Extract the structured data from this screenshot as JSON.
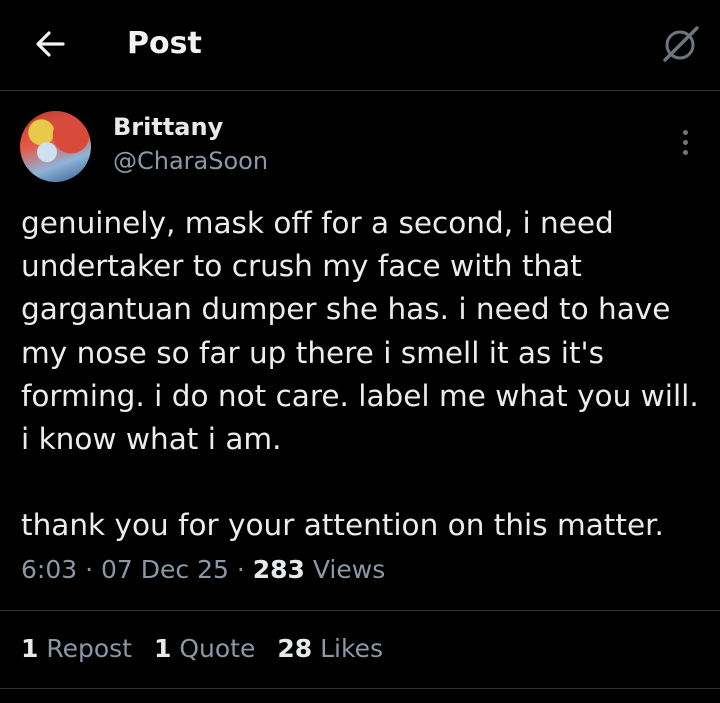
{
  "header": {
    "title": "Post",
    "back_icon": "arrow-left-icon",
    "grok_icon": "grok-icon"
  },
  "author": {
    "name": "Brittany",
    "handle": "@CharaSoon"
  },
  "post": {
    "text": "genuinely, mask off for a second, i need\nundertaker to crush my face with that\ngargantuan dumper she has. i need to have\nmy nose so far up there i smell it as it's\nforming. i do not care. label me what you will.\ni know what i am.\n\nthank you for your attention on this matter.",
    "time": "6:03",
    "date": "07 Dec 25",
    "views_count": "283",
    "views_label": "Views",
    "separator": " · "
  },
  "stats": {
    "reposts_count": "1",
    "reposts_label": "Repost",
    "quotes_count": "1",
    "quotes_label": "Quote",
    "likes_count": "28",
    "likes_label": "Likes"
  },
  "colors": {
    "background": "#000000",
    "text": "#e7e9ea",
    "muted": "#8b98a5",
    "divider": "#2f3336"
  }
}
